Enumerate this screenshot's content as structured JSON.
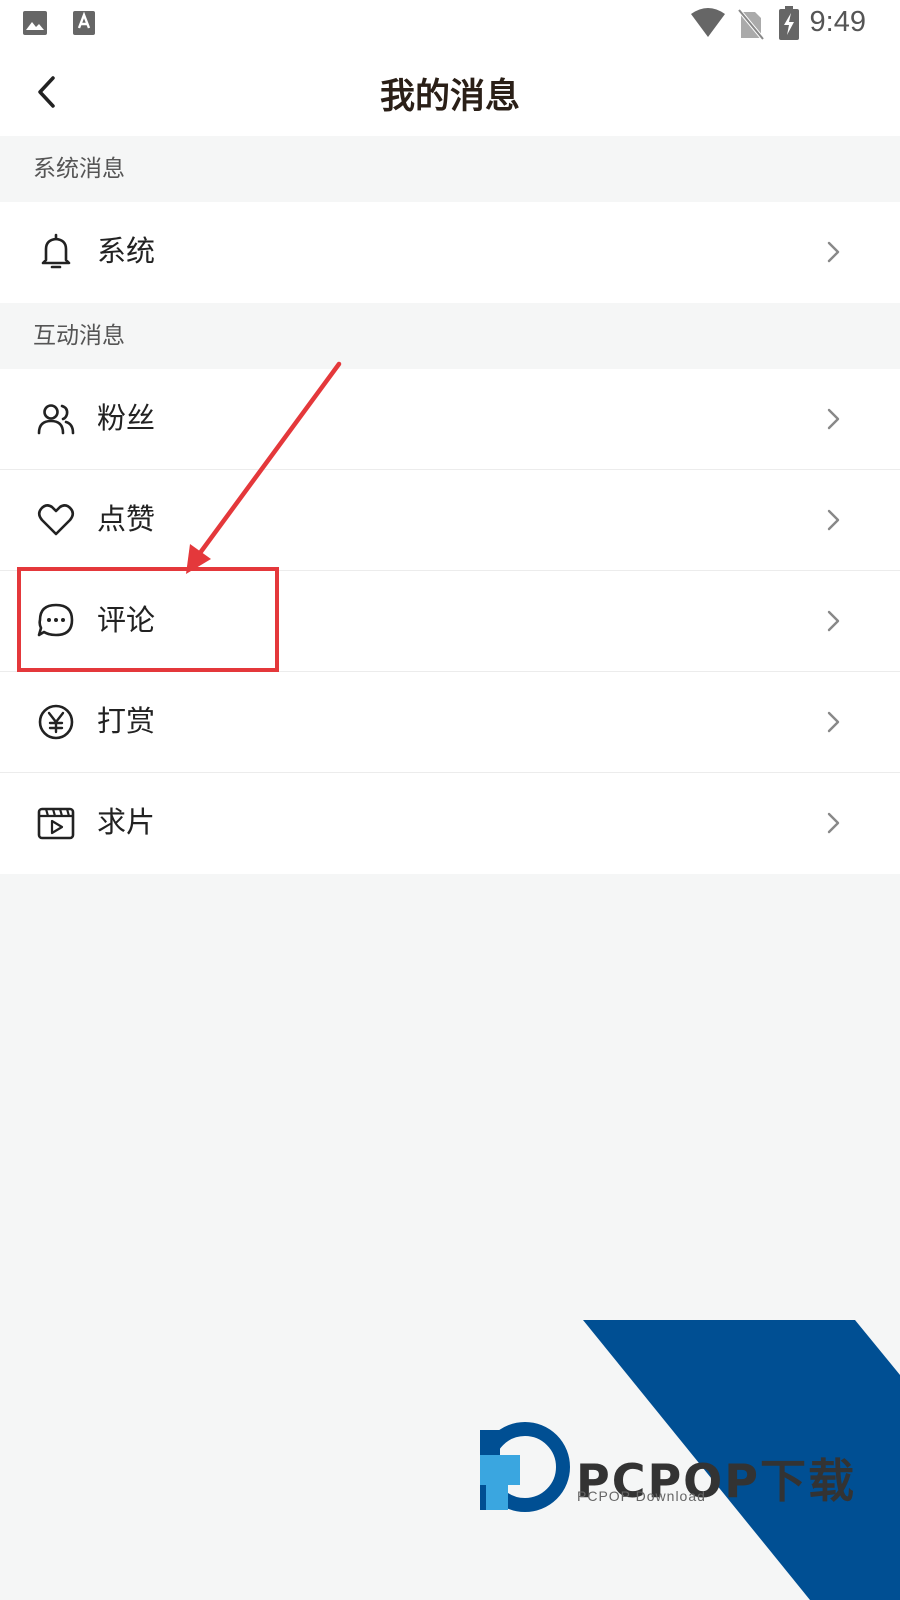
{
  "status_bar": {
    "time": "9:49",
    "left_icons": [
      "image-icon",
      "text-a-icon"
    ],
    "right_icons": [
      "wifi-icon",
      "no-sim-icon",
      "battery-charging-icon"
    ]
  },
  "header": {
    "title": "我的消息",
    "back_icon": "chevron-left-icon"
  },
  "sections": [
    {
      "title": "系统消息",
      "items": [
        {
          "label": "系统",
          "icon": "bell-icon"
        }
      ]
    },
    {
      "title": "互动消息",
      "items": [
        {
          "label": "粉丝",
          "icon": "users-icon"
        },
        {
          "label": "点赞",
          "icon": "heart-icon"
        },
        {
          "label": "评论",
          "icon": "comment-icon"
        },
        {
          "label": "打赏",
          "icon": "yen-icon"
        },
        {
          "label": "求片",
          "icon": "video-icon"
        }
      ]
    }
  ],
  "annotation": {
    "highlight_target": "评论",
    "color": "#e4383b"
  },
  "watermark": {
    "brand": "PCPOP下载",
    "subtitle": "PCPOP Download",
    "colors": {
      "blue": "#004f93",
      "light_blue": "#3aa6e0",
      "text": "#333333"
    }
  }
}
